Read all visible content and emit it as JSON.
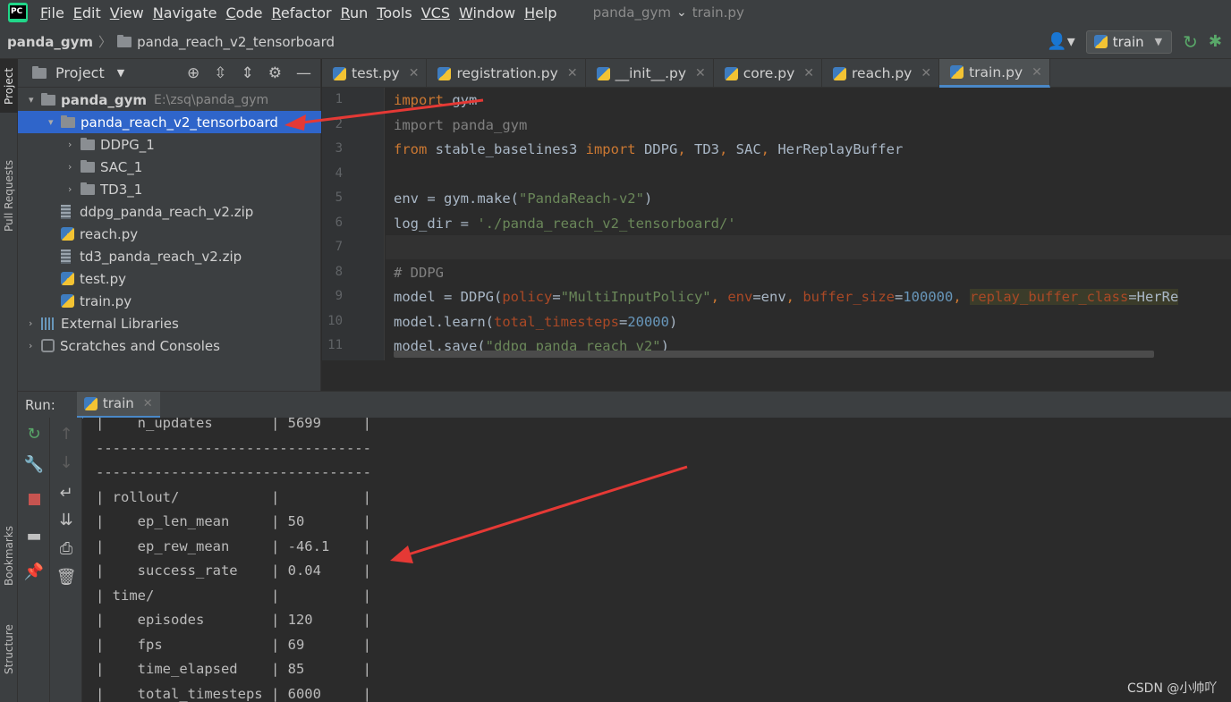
{
  "menu": {
    "items": [
      {
        "u": "F",
        "rest": "ile"
      },
      {
        "u": "E",
        "rest": "dit"
      },
      {
        "u": "V",
        "rest": "iew"
      },
      {
        "u": "N",
        "rest": "avigate"
      },
      {
        "u": "C",
        "rest": "ode"
      },
      {
        "u": "R",
        "rest": "efactor"
      },
      {
        "u": "R",
        "rest": "un"
      },
      {
        "u": "T",
        "rest": "ools"
      },
      {
        "u": "VCS",
        "rest": ""
      },
      {
        "u": "W",
        "rest": "indow"
      },
      {
        "u": "H",
        "rest": "elp"
      }
    ],
    "window_title_project": "panda_gym",
    "window_title_file": "train.py"
  },
  "nav": {
    "root": "panda_gym",
    "folder": "panda_reach_v2_tensorboard",
    "run_config": "train"
  },
  "side_tabs": {
    "project": "Project",
    "pull_requests": "Pull Requests",
    "bookmarks": "Bookmarks",
    "structure": "Structure"
  },
  "project": {
    "title": "Project",
    "tree": [
      {
        "label": "panda_gym",
        "hint": "E:\\zsq\\panda_gym",
        "type": "folder",
        "arrow": "▾",
        "indent": 0,
        "bold": true
      },
      {
        "label": "panda_reach_v2_tensorboard",
        "hint": "",
        "type": "folder",
        "arrow": "▾",
        "indent": 1,
        "selected": true
      },
      {
        "label": "DDPG_1",
        "hint": "",
        "type": "folder",
        "arrow": "›",
        "indent": 2
      },
      {
        "label": "SAC_1",
        "hint": "",
        "type": "folder",
        "arrow": "›",
        "indent": 2
      },
      {
        "label": "TD3_1",
        "hint": "",
        "type": "folder",
        "arrow": "›",
        "indent": 2
      },
      {
        "label": "ddpg_panda_reach_v2.zip",
        "hint": "",
        "type": "zip",
        "arrow": "",
        "indent": 1
      },
      {
        "label": "reach.py",
        "hint": "",
        "type": "py",
        "arrow": "",
        "indent": 1
      },
      {
        "label": "td3_panda_reach_v2.zip",
        "hint": "",
        "type": "zip",
        "arrow": "",
        "indent": 1
      },
      {
        "label": "test.py",
        "hint": "",
        "type": "py",
        "arrow": "",
        "indent": 1
      },
      {
        "label": "train.py",
        "hint": "",
        "type": "py",
        "arrow": "",
        "indent": 1
      },
      {
        "label": "External Libraries",
        "hint": "",
        "type": "lib",
        "arrow": "›",
        "indent": 0
      },
      {
        "label": "Scratches and Consoles",
        "hint": "",
        "type": "scratch",
        "arrow": "›",
        "indent": 0
      }
    ]
  },
  "editor": {
    "tabs": [
      {
        "label": "test.py",
        "active": false
      },
      {
        "label": "registration.py",
        "active": false
      },
      {
        "label": "__init__.py",
        "active": false
      },
      {
        "label": "core.py",
        "active": false
      },
      {
        "label": "reach.py",
        "active": false
      },
      {
        "label": "train.py",
        "active": true
      }
    ],
    "line_numbers": [
      "1",
      "2",
      "3",
      "4",
      "5",
      "6",
      "7",
      "8",
      "9",
      "10",
      "11"
    ],
    "lines": [
      [
        {
          "t": "import",
          "c": "kw"
        },
        {
          "t": " gym",
          "c": ""
        }
      ],
      [
        {
          "t": "import panda_gym",
          "c": "cmt"
        }
      ],
      [
        {
          "t": "from",
          "c": "kw"
        },
        {
          "t": " stable_baselines3 ",
          "c": ""
        },
        {
          "t": "import",
          "c": "kw"
        },
        {
          "t": " DDPG",
          "c": ""
        },
        {
          "t": ", ",
          "c": "kw"
        },
        {
          "t": "TD3",
          "c": ""
        },
        {
          "t": ", ",
          "c": "kw"
        },
        {
          "t": "SAC",
          "c": ""
        },
        {
          "t": ", ",
          "c": "kw"
        },
        {
          "t": "HerReplayBuffer",
          "c": ""
        }
      ],
      [],
      [
        {
          "t": "env = gym.make(",
          "c": ""
        },
        {
          "t": "\"PandaReach-v2\"",
          "c": "str"
        },
        {
          "t": ")",
          "c": ""
        }
      ],
      [
        {
          "t": "log_dir = ",
          "c": ""
        },
        {
          "t": "'./panda_reach_v2_tensorboard/'",
          "c": "str"
        }
      ],
      [],
      [
        {
          "t": "# DDPG",
          "c": "cmt"
        }
      ],
      [
        {
          "t": "model = DDPG(",
          "c": ""
        },
        {
          "t": "policy",
          "c": "param"
        },
        {
          "t": "=",
          "c": ""
        },
        {
          "t": "\"MultiInputPolicy\"",
          "c": "str"
        },
        {
          "t": ", ",
          "c": "kw"
        },
        {
          "t": "env",
          "c": "param"
        },
        {
          "t": "=env",
          "c": ""
        },
        {
          "t": ", ",
          "c": "kw"
        },
        {
          "t": "buffer_size",
          "c": "param"
        },
        {
          "t": "=",
          "c": ""
        },
        {
          "t": "100000",
          "c": "num"
        },
        {
          "t": ", ",
          "c": "kw"
        },
        {
          "t": "replay_buffer_class",
          "c": "param hl"
        },
        {
          "t": "=HerRe",
          "c": "hl"
        }
      ],
      [
        {
          "t": "model.learn(",
          "c": ""
        },
        {
          "t": "total_timesteps",
          "c": "param"
        },
        {
          "t": "=",
          "c": ""
        },
        {
          "t": "20000",
          "c": "num"
        },
        {
          "t": ")",
          "c": ""
        }
      ],
      [
        {
          "t": "model.save(",
          "c": ""
        },
        {
          "t": "\"ddpg_panda_reach_v2\"",
          "c": "str"
        },
        {
          "t": ")",
          "c": ""
        }
      ]
    ]
  },
  "run": {
    "label": "Run:",
    "tab": "train",
    "console_lines": [
      "|    n_updates       | 5699     |",
      "---------------------------------",
      "---------------------------------",
      "| rollout/           |          |",
      "|    ep_len_mean     | 50       |",
      "|    ep_rew_mean     | -46.1    |",
      "|    success_rate    | 0.04     |",
      "| time/              |          |",
      "|    episodes        | 120      |",
      "|    fps             | 69       |",
      "|    time_elapsed    | 85       |",
      "|    total_timesteps | 6000     |"
    ]
  },
  "watermark": "CSDN @小帅吖",
  "colors": {
    "selection": "#2f65ca",
    "annotation_arrow": "#e53935",
    "keyword": "#cc7832",
    "string": "#6a8759"
  }
}
